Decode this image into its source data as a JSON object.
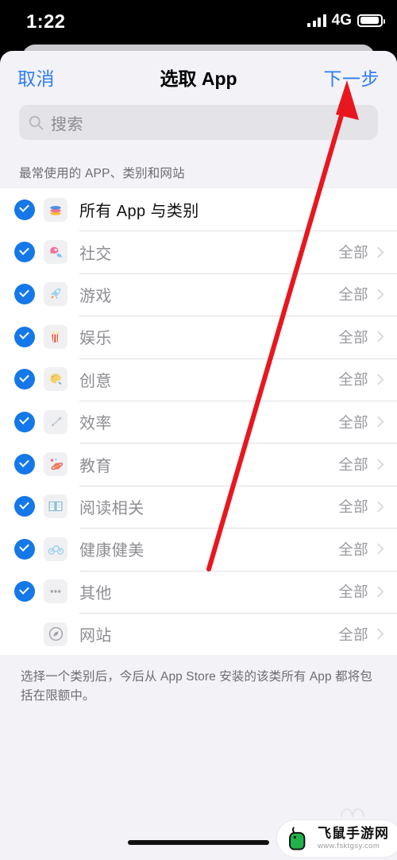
{
  "statusbar": {
    "time": "1:22",
    "network": "4G",
    "signal_icon": "signal-bars-icon",
    "battery_icon": "battery-icon"
  },
  "navbar": {
    "cancel_label": "取消",
    "title": "选取 App",
    "next_label": "下一步",
    "accent_color": "#2e7cf6"
  },
  "search": {
    "placeholder": "搜索",
    "value": "",
    "icon": "search-icon"
  },
  "section": {
    "header": "最常使用的 APP、类别和网站"
  },
  "list": {
    "rows": [
      {
        "label": "所有 App 与类别",
        "value": "",
        "checked": true,
        "emphasis": true,
        "icon": "stack-icon",
        "has_chevron": false
      },
      {
        "label": "社交",
        "value": "全部",
        "checked": true,
        "emphasis": false,
        "icon": "chat-bubbles-icon",
        "has_chevron": true
      },
      {
        "label": "游戏",
        "value": "全部",
        "checked": true,
        "emphasis": false,
        "icon": "rocket-icon",
        "has_chevron": true
      },
      {
        "label": "娱乐",
        "value": "全部",
        "checked": true,
        "emphasis": false,
        "icon": "popcorn-icon",
        "has_chevron": true
      },
      {
        "label": "创意",
        "value": "全部",
        "checked": true,
        "emphasis": false,
        "icon": "palette-icon",
        "has_chevron": true
      },
      {
        "label": "效率",
        "value": "全部",
        "checked": true,
        "emphasis": false,
        "icon": "pen-icon",
        "has_chevron": true
      },
      {
        "label": "教育",
        "value": "全部",
        "checked": true,
        "emphasis": false,
        "icon": "planet-icon",
        "has_chevron": true
      },
      {
        "label": "阅读相关",
        "value": "全部",
        "checked": true,
        "emphasis": false,
        "icon": "open-book-icon",
        "has_chevron": true
      },
      {
        "label": "健康健美",
        "value": "全部",
        "checked": true,
        "emphasis": false,
        "icon": "bicycle-icon",
        "has_chevron": true
      },
      {
        "label": "其他",
        "value": "全部",
        "checked": true,
        "emphasis": false,
        "icon": "ellipsis-icon",
        "has_chevron": true
      },
      {
        "label": "网站",
        "value": "全部",
        "checked": false,
        "emphasis": false,
        "icon": "compass-icon",
        "has_chevron": true
      }
    ]
  },
  "footer": {
    "note": "选择一个类别后，今后从 App Store 安装的该类所有 App 都将包括在限额中。"
  },
  "annotation": {
    "arrow_color": "#e8171f",
    "arrow_points_to": "下一步"
  },
  "watermark": {
    "name": "飞鼠手游网",
    "url": "www.fsktgsy.com",
    "logo_icon": "green-mouse-icon"
  }
}
